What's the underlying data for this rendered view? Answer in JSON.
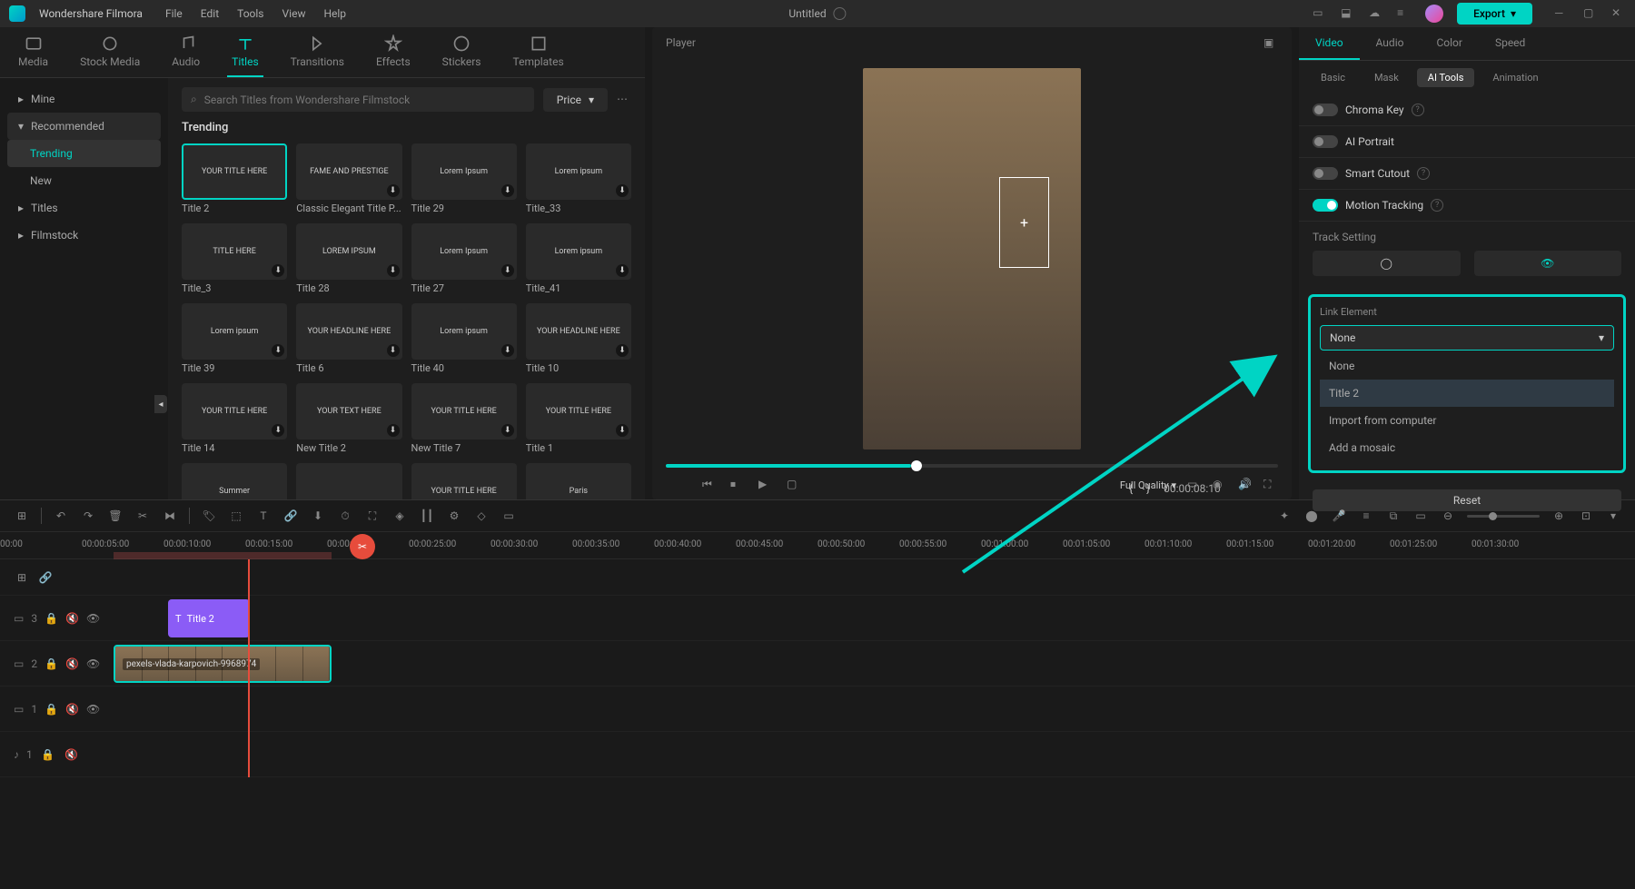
{
  "app": {
    "name": "Wondershare Filmora",
    "title": "Untitled"
  },
  "menu": [
    "File",
    "Edit",
    "Tools",
    "View",
    "Help"
  ],
  "export": "Export",
  "tabs": [
    {
      "label": "Media"
    },
    {
      "label": "Stock Media"
    },
    {
      "label": "Audio"
    },
    {
      "label": "Titles",
      "active": true
    },
    {
      "label": "Transitions"
    },
    {
      "label": "Effects"
    },
    {
      "label": "Stickers"
    },
    {
      "label": "Templates"
    }
  ],
  "sidebar": {
    "mine": "Mine",
    "recommended": "Recommended",
    "trending": "Trending",
    "new": "New",
    "titles": "Titles",
    "filmstock": "Filmstock"
  },
  "search": {
    "placeholder": "Search Titles from Wondershare Filmstock"
  },
  "sort": "Price",
  "gallery": {
    "heading": "Trending",
    "items": [
      {
        "thumb": "YOUR TITLE HERE",
        "label": "Title 2",
        "sel": true
      },
      {
        "thumb": "FAME AND PRESTIGE",
        "label": "Classic Elegant Title P..."
      },
      {
        "thumb": "Lorem Ipsum",
        "label": "Title 29"
      },
      {
        "thumb": "Lorem ipsum",
        "label": "Title_33"
      },
      {
        "thumb": "TITLE HERE",
        "label": "Title_3"
      },
      {
        "thumb": "LOREM IPSUM",
        "label": "Title 28"
      },
      {
        "thumb": "Lorem Ipsum",
        "label": "Title 27"
      },
      {
        "thumb": "Lorem ipsum",
        "label": "Title_41"
      },
      {
        "thumb": "Lorem ipsum",
        "label": "Title 39"
      },
      {
        "thumb": "YOUR HEADLINE HERE",
        "label": "Title 6"
      },
      {
        "thumb": "Lorem ipsum",
        "label": "Title 40"
      },
      {
        "thumb": "YOUR HEADLINE HERE",
        "label": "Title 10"
      },
      {
        "thumb": "YOUR TITLE HERE",
        "label": "Title 14"
      },
      {
        "thumb": "YOUR TEXT HERE",
        "label": "New Title 2"
      },
      {
        "thumb": "YOUR TITLE HERE",
        "label": "New Title 7"
      },
      {
        "thumb": "YOUR TITLE HERE",
        "label": "Title 1"
      },
      {
        "thumb": "Summer",
        "label": ""
      },
      {
        "thumb": "",
        "label": ""
      },
      {
        "thumb": "YOUR TITLE HERE",
        "label": ""
      },
      {
        "thumb": "Paris",
        "label": ""
      }
    ]
  },
  "player": {
    "label": "Player",
    "quality": "Full Quality",
    "time": "00:00:08:10"
  },
  "markers": {
    "left": "{",
    "right": "}"
  },
  "right": {
    "tabs": [
      "Video",
      "Audio",
      "Color",
      "Speed"
    ],
    "subtabs": [
      "Basic",
      "Mask",
      "AI Tools",
      "Animation"
    ],
    "chroma": "Chroma Key",
    "portrait": "AI Portrait",
    "cutout": "Smart Cutout",
    "motion": "Motion Tracking",
    "tracksetting": "Track Setting",
    "link": {
      "label": "Link Element",
      "value": "None",
      "options": [
        "None",
        "Title 2",
        "Import from computer",
        "Add a mosaic"
      ]
    },
    "reset": "Reset"
  },
  "ruler": [
    "00:00",
    "00:00:05:00",
    "00:00:10:00",
    "00:00:15:00",
    "00:00:20:00",
    "00:00:25:00",
    "00:00:30:00",
    "00:00:35:00",
    "00:00:40:00",
    "00:00:45:00",
    "00:00:50:00",
    "00:00:55:00",
    "00:01:00:00",
    "00:01:05:00",
    "00:01:10:00",
    "00:01:15:00",
    "00:01:20:00",
    "00:01:25:00",
    "00:01:30:00"
  ],
  "tracks": {
    "t3": "3",
    "t2": "2",
    "t1": "1",
    "a1": "1",
    "titleclip": "Title 2",
    "videoclip": "pexels-vlada-karpovich-9968974"
  }
}
